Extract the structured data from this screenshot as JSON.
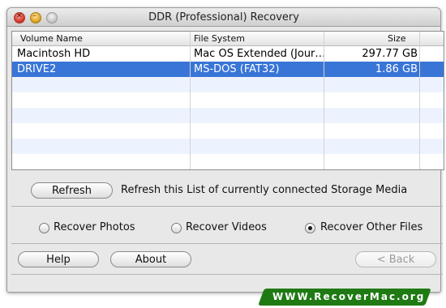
{
  "window": {
    "title": "DDR (Professional) Recovery"
  },
  "table": {
    "headers": [
      "Volume Name",
      "File System",
      "Size"
    ],
    "rows": [
      {
        "volume": "Macintosh HD",
        "fs": "Mac OS Extended (Jour…",
        "size": "297.77  GB"
      },
      {
        "volume": "DRIVE2",
        "fs": "MS-DOS (FAT32)",
        "size": "1.86  GB"
      }
    ],
    "selected_row": 1
  },
  "refresh": {
    "label": "Refresh",
    "description": "Refresh this List of currently connected Storage Media"
  },
  "options": {
    "photos": "Recover Photos",
    "videos": "Recover Videos",
    "other": "Recover Other Files",
    "selected": "other"
  },
  "buttons": {
    "help": "Help",
    "about": "About",
    "back": "< Back"
  },
  "watermark": "WWW.RecoverMac.org"
}
